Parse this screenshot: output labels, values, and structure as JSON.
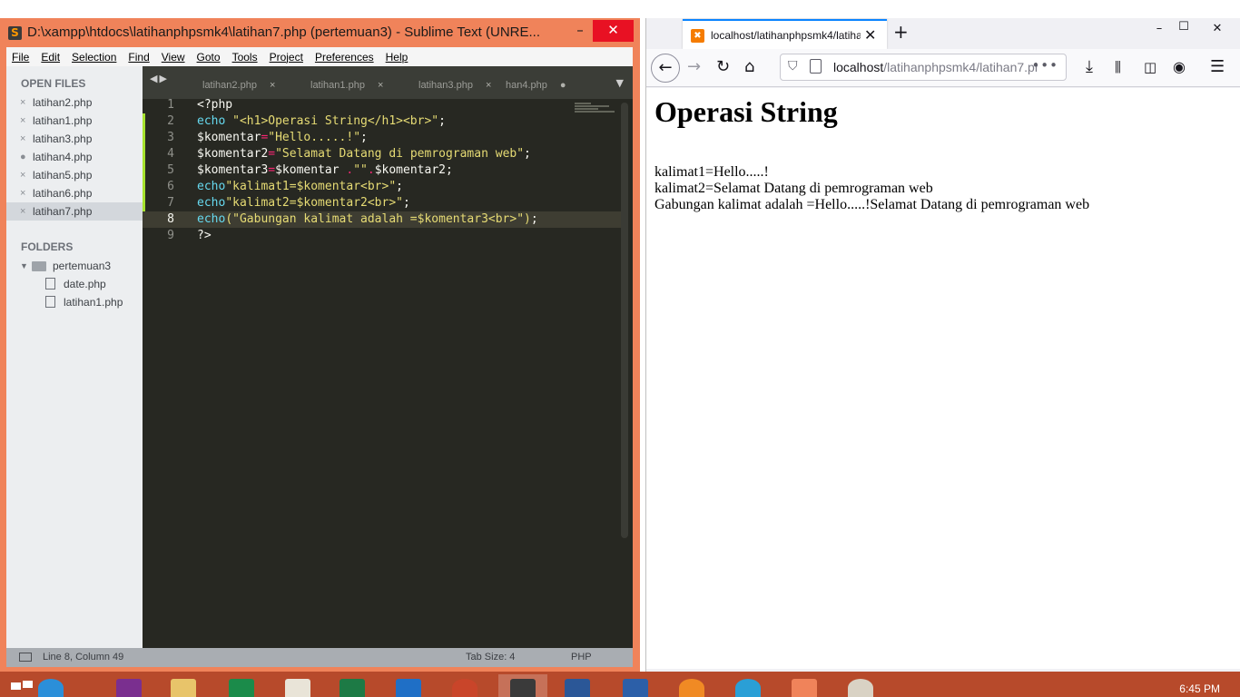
{
  "sublime": {
    "title": "D:\\xampp\\htdocs\\latihanphpsmk4\\latihan7.php (pertemuan3) - Sublime Text (UNRE...",
    "window_controls": {
      "minimize": "–",
      "maximize": "☐",
      "close": "✕"
    },
    "menu": [
      "File",
      "Edit",
      "Selection",
      "Find",
      "View",
      "Goto",
      "Tools",
      "Project",
      "Preferences",
      "Help"
    ],
    "open_files_header": "OPEN FILES",
    "open_files": [
      {
        "mark": "×",
        "name": "latihan2.php"
      },
      {
        "mark": "×",
        "name": "latihan1.php"
      },
      {
        "mark": "×",
        "name": "latihan3.php"
      },
      {
        "mark": "●",
        "name": "latihan4.php"
      },
      {
        "mark": "×",
        "name": "latihan5.php"
      },
      {
        "mark": "×",
        "name": "latihan6.php"
      },
      {
        "mark": "×",
        "name": "latihan7.php"
      }
    ],
    "folders_header": "FOLDERS",
    "folder": {
      "name": "pertemuan3",
      "files": [
        "date.php",
        "latihan1.php"
      ]
    },
    "tabs": [
      {
        "label": "latihan2.php",
        "close": "×"
      },
      {
        "label": "latihan1.php",
        "close": "×"
      },
      {
        "label": "latihan3.php",
        "close": "×"
      },
      {
        "label": "han4.php",
        "close": "●"
      }
    ],
    "line_numbers": [
      "1",
      "2",
      "3",
      "4",
      "5",
      "6",
      "7",
      "8",
      "9"
    ],
    "code": {
      "l1": "<?php",
      "l2_kw": "echo",
      "l2_str": " \"<h1>Operasi String</h1><br>\"",
      "l2_end": ";",
      "l3_var": "$komentar",
      "l3_op": "=",
      "l3_str": "\"Hello.....!\"",
      "l3_end": ";",
      "l4_var": "$komentar2",
      "l4_op": "=",
      "l4_str": "\"Selamat Datang di pemrograman web\"",
      "l4_end": ";",
      "l5_a": "$komentar3",
      "l5_op": "=",
      "l5_b": "$komentar ",
      "l5_dot": ".",
      "l5_str": "\"\"",
      "l5_dot2": ".",
      "l5_c": "$komentar2;",
      "l6_kw": "echo",
      "l6_str": "\"kalimat1=$komentar<br>\"",
      "l6_end": ";",
      "l7_kw": "echo",
      "l7_str": "\"kalimat2=$komentar2<br>\"",
      "l7_end": ";",
      "l8_kw": "echo",
      "l8_str": "(\"Gabungan kalimat adalah =$komentar3<br>\")",
      "l8_end": ";",
      "l9": "?>"
    },
    "status": {
      "position": "Line 8, Column 49",
      "tab_size": "Tab Size: 4",
      "syntax": "PHP"
    }
  },
  "firefox": {
    "tab_title": "localhost/latihanphpsmk4/latihan7.php",
    "tab_close": "✕",
    "new_tab": "+",
    "window_controls": {
      "minimize": "–",
      "maximize": "☐",
      "close": "✕"
    },
    "url_host": "localhost",
    "url_path": "/latihanphpsmk4/latihan7.php",
    "url_more": "•••",
    "page": {
      "heading": "Operasi String",
      "lines": [
        "kalimat1=Hello.....!",
        "kalimat2=Selamat Datang di pemrograman web",
        "Gabungan kalimat adalah =Hello.....!Selamat Datang di pemrograman web"
      ]
    }
  },
  "taskbar": {
    "clock": "6:45 PM"
  },
  "colors": {
    "sublime_chrome": "#f0835a",
    "editor_bg": "#272822",
    "taskbar": "#b74a2b",
    "firefox_accent": "#0a84ff"
  }
}
